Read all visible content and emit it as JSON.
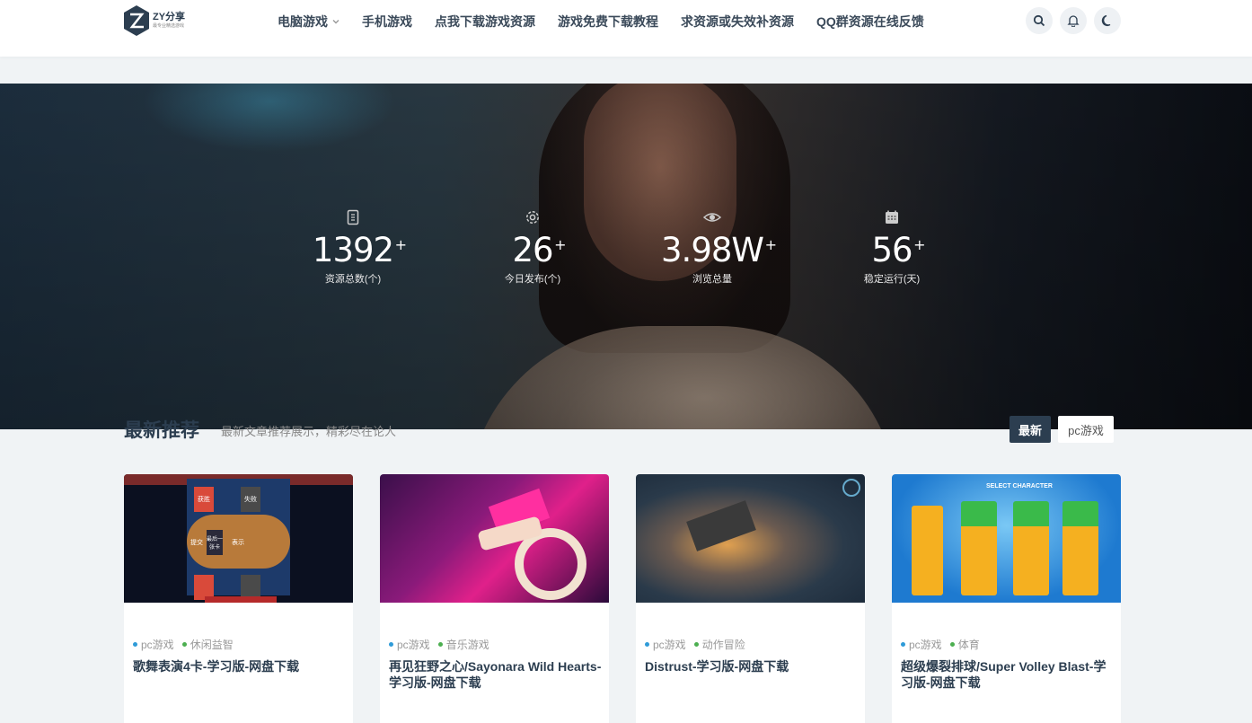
{
  "header": {
    "logo": {
      "title": "ZY分享",
      "subtitle": "最专业精选游戏"
    },
    "nav": [
      {
        "label": "电脑游戏",
        "has_dropdown": true
      },
      {
        "label": "手机游戏"
      },
      {
        "label": "点我下载游戏资源"
      },
      {
        "label": "游戏免费下载教程"
      },
      {
        "label": "求资源或失效补资源"
      },
      {
        "label": "QQ群资源在线反馈"
      }
    ],
    "icons": [
      "search-icon",
      "bell-icon",
      "moon-icon"
    ]
  },
  "hero": {
    "stats": [
      {
        "icon": "file-icon",
        "value": "1392",
        "suffix": "+",
        "label": "资源总数(个)"
      },
      {
        "icon": "gear-icon",
        "value": "26",
        "suffix": "+",
        "label": "今日发布(个)"
      },
      {
        "icon": "eye-icon",
        "value": "3.98W",
        "suffix": "+",
        "label": "浏览总量"
      },
      {
        "icon": "calendar-icon",
        "value": "56",
        "suffix": "+",
        "label": "稳定运行(天)"
      }
    ]
  },
  "section": {
    "title": "最新推荐",
    "subtitle": "最新文章推荐展示，精彩尽在论人",
    "tabs": [
      {
        "label": "最新",
        "active": true
      },
      {
        "label": "pc游戏",
        "active": false
      }
    ]
  },
  "cards": [
    {
      "tags": [
        {
          "label": "pc游戏",
          "color": "#2f9bd8"
        },
        {
          "label": "休闲益智",
          "color": "#4caf50"
        }
      ],
      "title": "歌舞表演4卡-学习版-网盘下载",
      "thumb_text": {
        "win": "获胜",
        "lose": "失败",
        "submit": "提交",
        "show": "表示",
        "last": "最后一张卡"
      }
    },
    {
      "tags": [
        {
          "label": "pc游戏",
          "color": "#2f9bd8"
        },
        {
          "label": "音乐游戏",
          "color": "#4caf50"
        }
      ],
      "title": "再见狂野之心/Sayonara Wild Hearts-学习版-网盘下载"
    },
    {
      "tags": [
        {
          "label": "pc游戏",
          "color": "#2f9bd8"
        },
        {
          "label": "动作冒险",
          "color": "#4caf50"
        }
      ],
      "title": "Distrust-学习版-网盘下载"
    },
    {
      "tags": [
        {
          "label": "pc游戏",
          "color": "#2f9bd8"
        },
        {
          "label": "体育",
          "color": "#4caf50"
        }
      ],
      "title": "超级爆裂排球/Super Volley Blast-学习版-网盘下载",
      "thumb_text": {
        "heading": "SELECT CHARACTER"
      }
    }
  ]
}
